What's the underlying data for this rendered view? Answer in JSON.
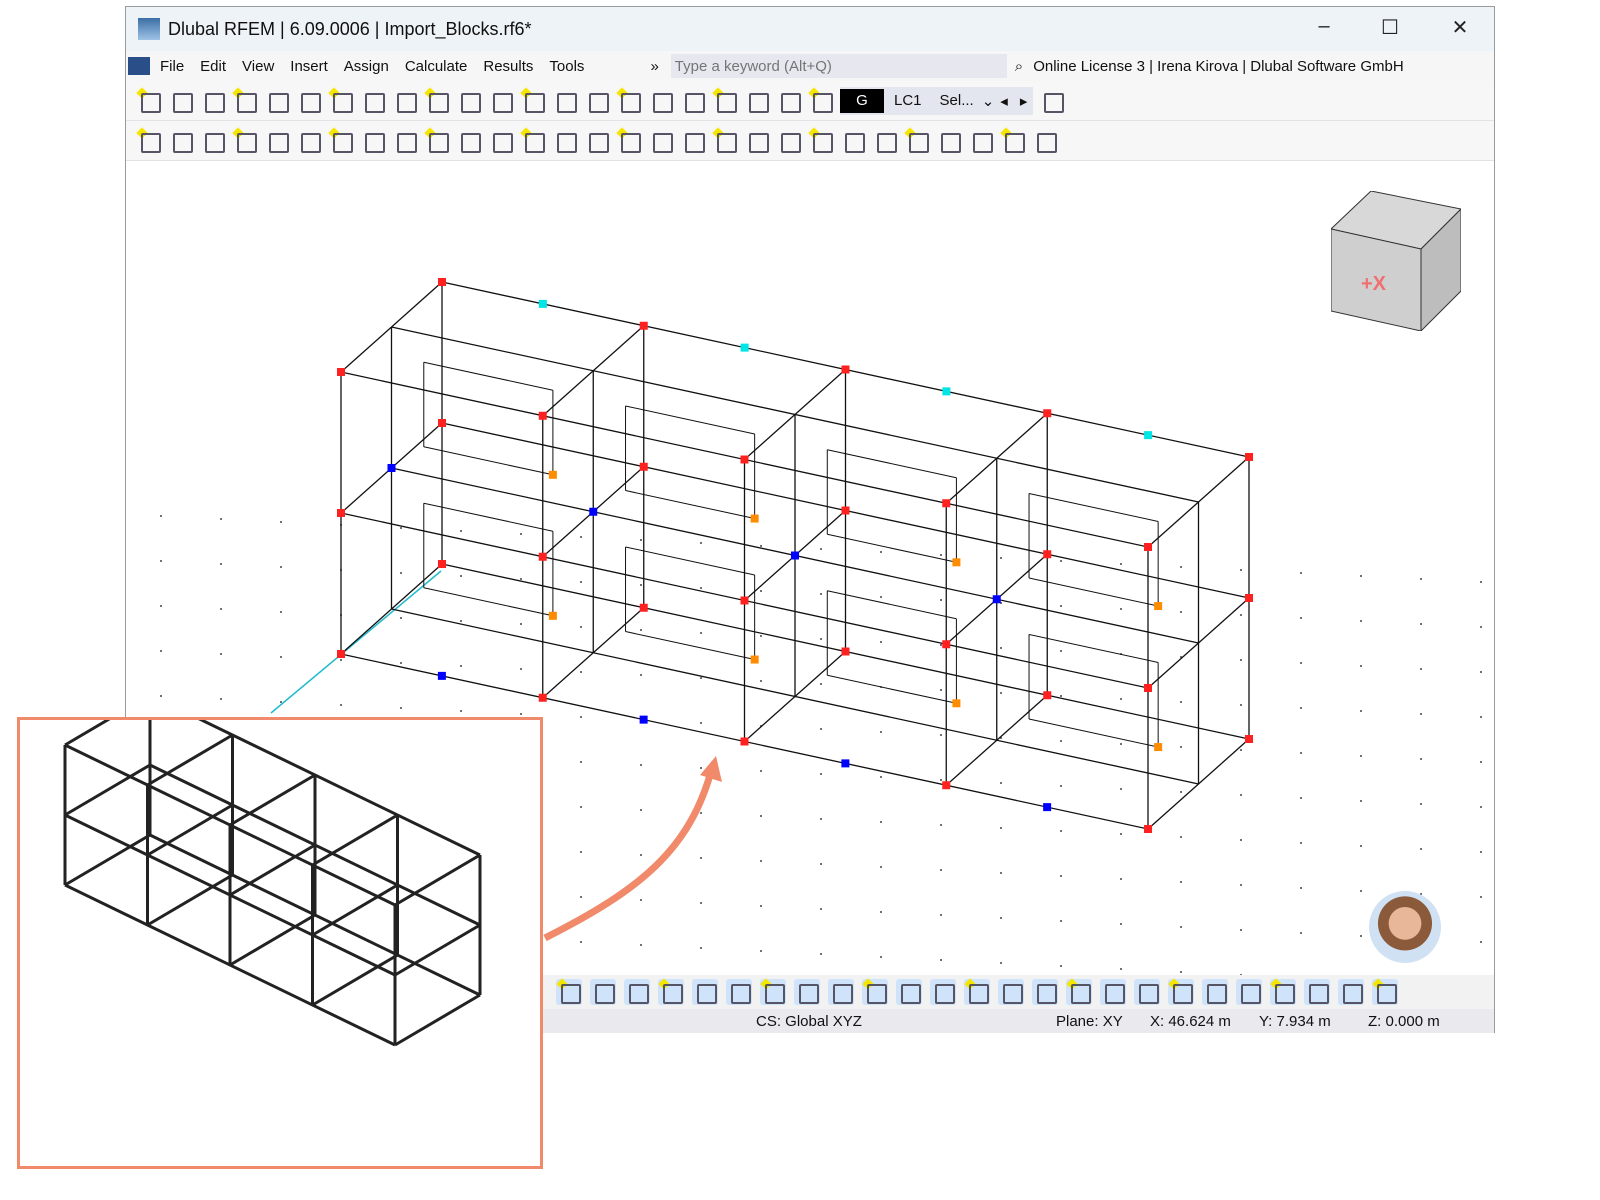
{
  "window": {
    "title": "Dlubal RFEM | 6.09.0006 | Import_Blocks.rf6*"
  },
  "menu": {
    "items": [
      "File",
      "Edit",
      "View",
      "Insert",
      "Assign",
      "Calculate",
      "Results",
      "Tools"
    ],
    "overflow": "»",
    "search_placeholder": "Type a keyword (Alt+Q)",
    "license": "Online License 3 | Irena Kirova | Dlubal Software GmbH"
  },
  "toolbar1": {
    "icons": [
      "new-model-icon",
      "open-icon",
      "dlubal-center-icon",
      "webservice-icon",
      "model-data-icon",
      "save-icon",
      "print-icon",
      "new-report-icon",
      "report-icon",
      "undo-icon",
      "redo-icon",
      "table-icon",
      "table-grid-icon",
      "diagram-icon",
      "document-icon",
      "console-icon",
      "script-icon",
      "list-icon",
      "bug-icon",
      "select-icon",
      "add-note-icon",
      "load-icon",
      "load-2-icon"
    ],
    "load_case_color": "G",
    "load_case": "LC1",
    "selection": "Sel..."
  },
  "toolbar2": {
    "icons": [
      "new-node-icon",
      "new-line-icon",
      "new-member-icon",
      "new-polyline-icon",
      "support-icon",
      "hinge-icon",
      "spring-icon",
      "new-surface-icon",
      "new-opening-icon",
      "new-solid-icon",
      "new-block-icon",
      "box-icon",
      "column-icon",
      "nodal-load-icon",
      "line-load-icon",
      "member-load-icon",
      "imperfection-icon",
      "result-icon",
      "pointer-icon",
      "filter-icon",
      "graph-icon",
      "section-icon",
      "film-icon",
      "deform-icon",
      "plate-icon",
      "cube-icon",
      "arrows-icon",
      "ruler-icon",
      "grid-icon"
    ]
  },
  "bottombar": {
    "icons": [
      "snap-icon",
      "grid-view-icon",
      "grid-snap-icon",
      "object-snap-icon",
      "guide-line-icon",
      "coordinate-icon",
      "snap-grid-icon",
      "magnet-icon",
      "rectangle-snap-icon",
      "circle-cross-icon",
      "box-cross-icon",
      "perpendicular-icon",
      "line-snap-icon",
      "parallel-icon",
      "tangent-icon",
      "quadrant-icon",
      "intersection-icon",
      "extension-icon",
      "midpoint-icon",
      "points-icon",
      "grid-display-icon",
      "grid-dots-icon",
      "layers-icon",
      "member-snap-icon",
      "workplane-icon"
    ]
  },
  "status": {
    "cs": "CS: Global XYZ",
    "plane": "Plane: XY",
    "x": "X: 46.624 m",
    "y": "Y: 7.934 m",
    "z": "Z: 0.000 m"
  },
  "navcube": {
    "label": "+X"
  },
  "colors": {
    "accent": "#f08a6a",
    "node": "#ff2020",
    "member_node": "#0000ff"
  }
}
